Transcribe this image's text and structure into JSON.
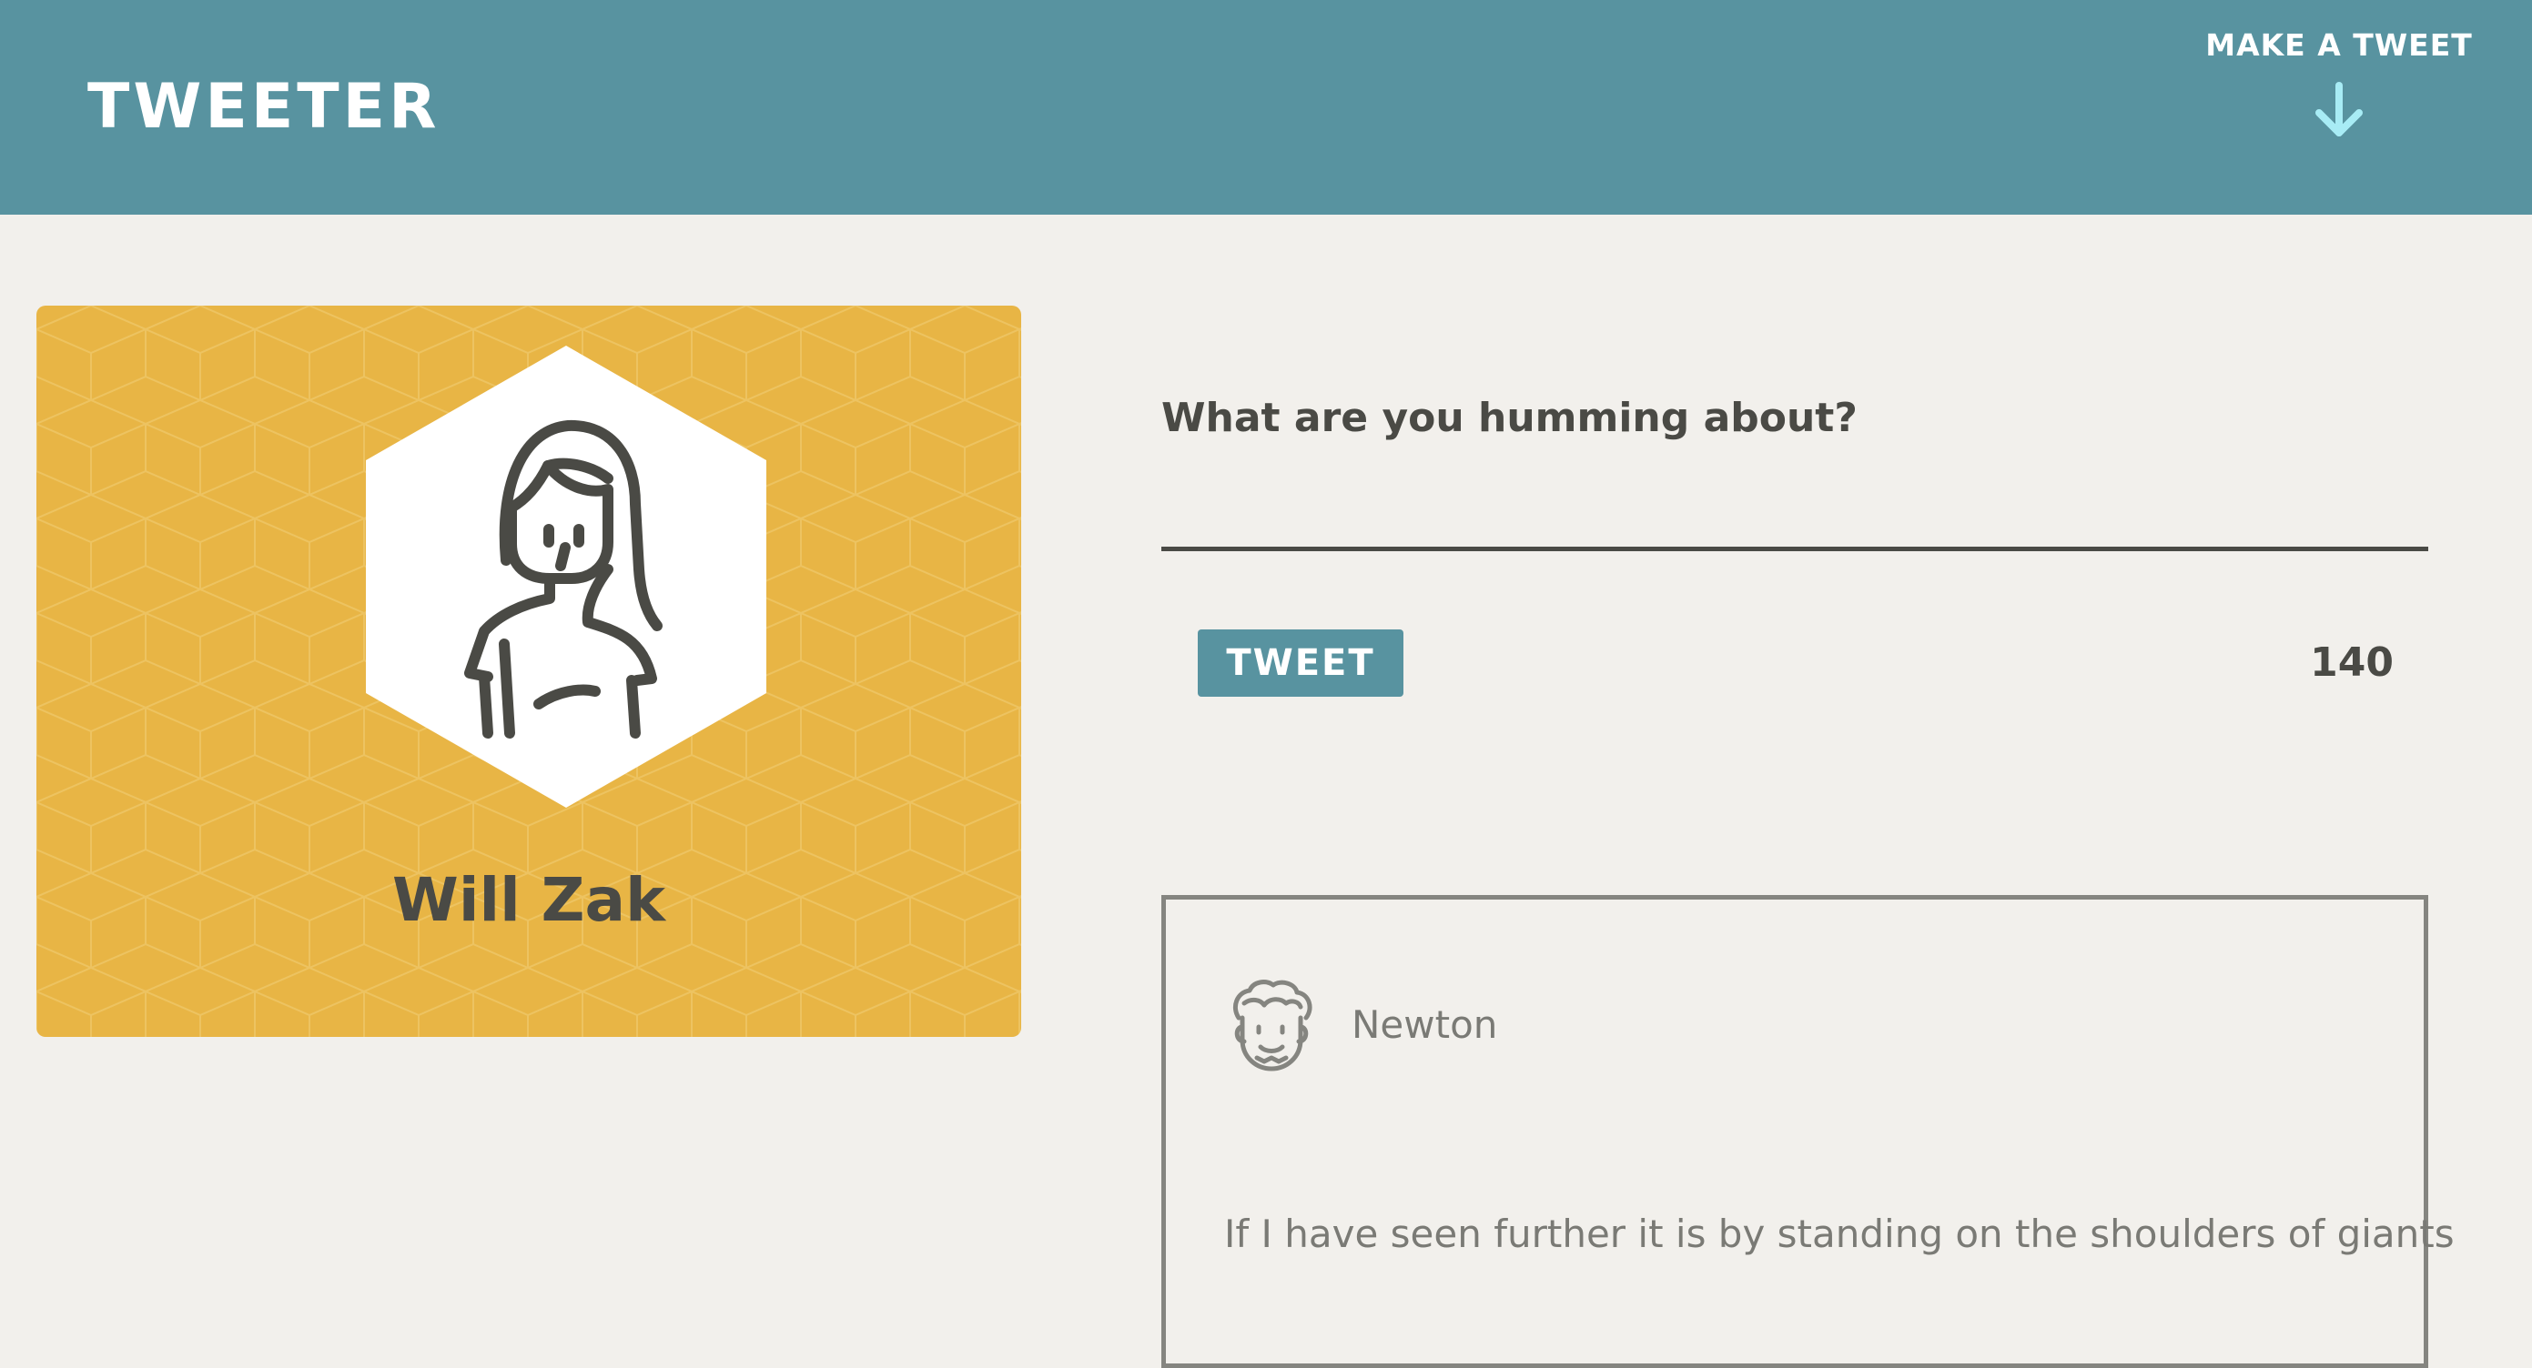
{
  "app": {
    "brand": "TWEETER",
    "nav_cta": "MAKE A TWEET",
    "nav_cta_icon": "arrow-down-icon"
  },
  "colors": {
    "header": "#5893a0",
    "accent_card": "#e8b545",
    "background": "#f2f0ec",
    "text": "#4a4a45",
    "arrow": "#a8ecf5"
  },
  "profile": {
    "name": "Will Zak",
    "avatar_icon": "woman-avatar-icon"
  },
  "compose": {
    "label": "What are you humming about?",
    "input_value": "",
    "button_label": "TWEET",
    "char_count": "140"
  },
  "tweets": [
    {
      "user": "Newton",
      "avatar_icon": "curly-hair-man-avatar-icon",
      "text": "If I have seen further it is by standing on the shoulders of giants"
    }
  ]
}
